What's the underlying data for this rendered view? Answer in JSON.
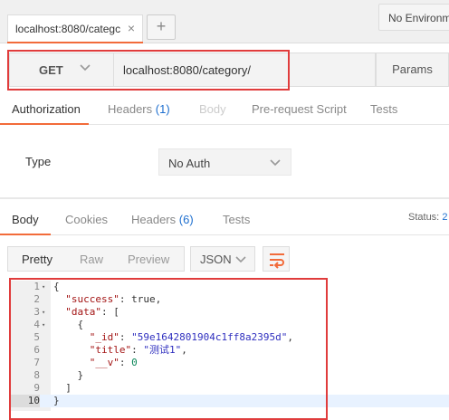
{
  "tabs": {
    "request_tab_label": "localhost:8080/categc",
    "close_glyph": "×",
    "add_glyph": "+",
    "environment": "No Environment"
  },
  "request": {
    "method": "GET",
    "url": "localhost:8080/category/",
    "params_label": "Params"
  },
  "request_tabs": [
    {
      "label": "Authorization"
    },
    {
      "label": "Headers",
      "count": "(1)"
    },
    {
      "label": "Body"
    },
    {
      "label": "Pre-request Script"
    },
    {
      "label": "Tests"
    }
  ],
  "auth": {
    "type_label": "Type",
    "type_value": "No Auth"
  },
  "response_tabs": [
    {
      "label": "Body"
    },
    {
      "label": "Cookies"
    },
    {
      "label": "Headers",
      "count": "(6)"
    },
    {
      "label": "Tests"
    }
  ],
  "status": {
    "label": "Status:",
    "value": "2"
  },
  "view": {
    "pretty": "Pretty",
    "raw": "Raw",
    "preview": "Preview",
    "format": "JSON"
  },
  "code_lines": [
    {
      "n": "1",
      "fold": true,
      "text": "{"
    },
    {
      "n": "2",
      "fold": false,
      "text": "  \"success\": true,"
    },
    {
      "n": "3",
      "fold": true,
      "text": "  \"data\": ["
    },
    {
      "n": "4",
      "fold": true,
      "text": "    {"
    },
    {
      "n": "5",
      "fold": false,
      "text": "      \"_id\": \"59e1642801904c1ff8a2395d\","
    },
    {
      "n": "6",
      "fold": false,
      "text": "      \"title\": \"测试1\","
    },
    {
      "n": "7",
      "fold": false,
      "text": "      \"__v\": 0"
    },
    {
      "n": "8",
      "fold": false,
      "text": "    }"
    },
    {
      "n": "9",
      "fold": false,
      "text": "  ]"
    },
    {
      "n": "10",
      "fold": false,
      "text": "}"
    }
  ],
  "colors": {
    "accent": "#f26b3a",
    "highlight_box": "#e03c3c",
    "link_blue": "#1e6fcf"
  }
}
